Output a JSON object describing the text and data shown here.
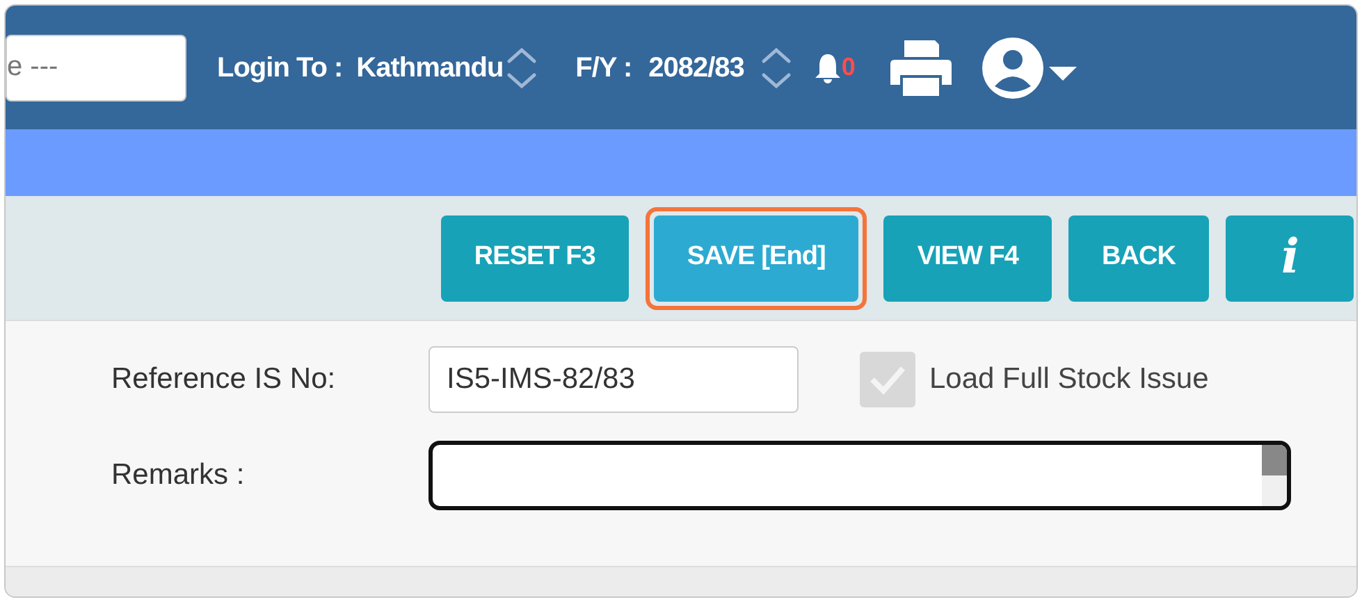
{
  "header": {
    "search": {
      "placeholder": "e ---"
    },
    "login": {
      "label": "Login To :",
      "value": "Kathmandu"
    },
    "fiscal_year": {
      "label": "F/Y :",
      "value": "2082/83"
    },
    "notifications": {
      "count": "0"
    }
  },
  "toolbar": {
    "buttons": [
      {
        "label": "RESET F3",
        "kind": "text",
        "selected": false
      },
      {
        "label": "SAVE [End]",
        "kind": "text",
        "selected": true
      },
      {
        "label": "VIEW F4",
        "kind": "text",
        "selected": false
      },
      {
        "label": "BACK",
        "kind": "text",
        "selected": false
      },
      {
        "label": "i",
        "kind": "info",
        "selected": false
      }
    ]
  },
  "form": {
    "reference": {
      "label": "Reference IS No:",
      "value": "IS5-IMS-82/83"
    },
    "load_full": {
      "label": "Load Full Stock Issue",
      "checked": true,
      "disabled": true
    },
    "remarks": {
      "label": "Remarks :"
    }
  }
}
